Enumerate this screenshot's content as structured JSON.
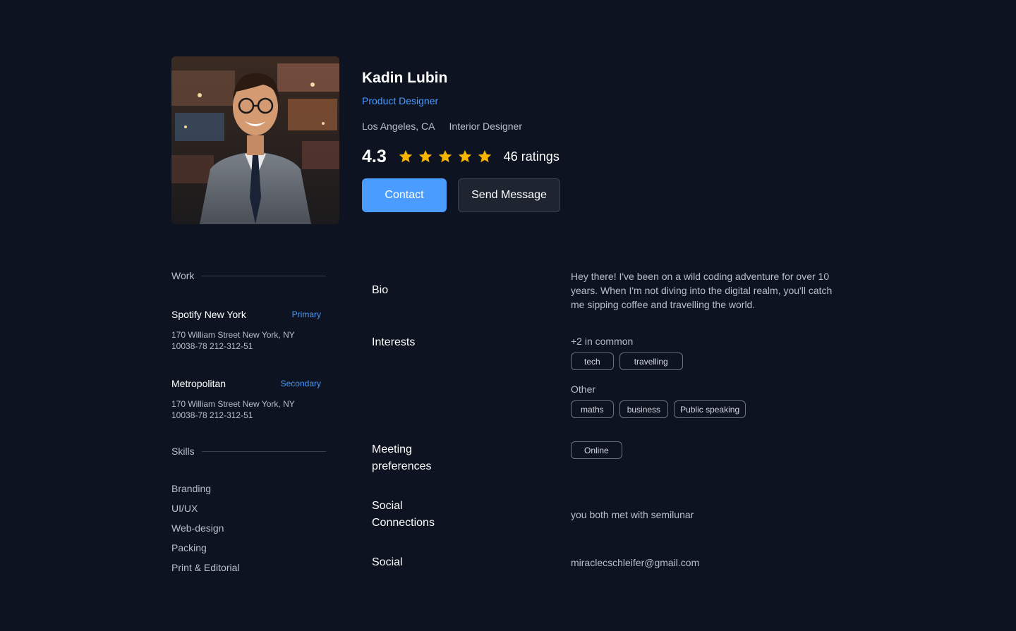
{
  "profile": {
    "name": "Kadin Lubin",
    "role": "Product Designer",
    "location": "Los Angeles, CA",
    "secondary_role": "Interior Designer",
    "rating": "4.3",
    "stars": 5,
    "ratings_count": "46 ratings"
  },
  "actions": {
    "contact_label": "Contact",
    "message_label": "Send Message"
  },
  "work": {
    "heading": "Work",
    "items": [
      {
        "name": "Spotify New York",
        "badge": "Primary",
        "address": "170 William Street New York, NY 10038-78 212-312-51"
      },
      {
        "name": "Metropolitan",
        "badge": "Secondary",
        "address": "170 William Street New York, NY 10038-78 212-312-51"
      }
    ]
  },
  "skills": {
    "heading": "Skills",
    "items": [
      "Branding",
      "UI/UX",
      "Web-design",
      "Packing",
      "Print & Editorial"
    ]
  },
  "bio": {
    "label": "Bio",
    "text": "Hey there! I've been on a wild coding adventure for over 10 years. When I'm not diving into the digital realm, you'll catch me sipping coffee and travelling the world."
  },
  "interests": {
    "label": "Interests",
    "common_label": "+2 in common",
    "common": [
      "tech",
      "travelling"
    ],
    "other_label": "Other",
    "other": [
      "maths",
      "business",
      "Public speaking"
    ]
  },
  "meeting": {
    "label_line1": "Meeting",
    "label_line2": "preferences",
    "options": [
      "Online"
    ]
  },
  "social_connections": {
    "label_line1": "Social",
    "label_line2": "Connections",
    "text": "you both met with semilunar"
  },
  "social": {
    "label": "Social",
    "email": "miraclecschleifer@gmail.com"
  },
  "colors": {
    "background": "#0d1320",
    "accent": "#4a9cff",
    "star": "#f7b500"
  }
}
